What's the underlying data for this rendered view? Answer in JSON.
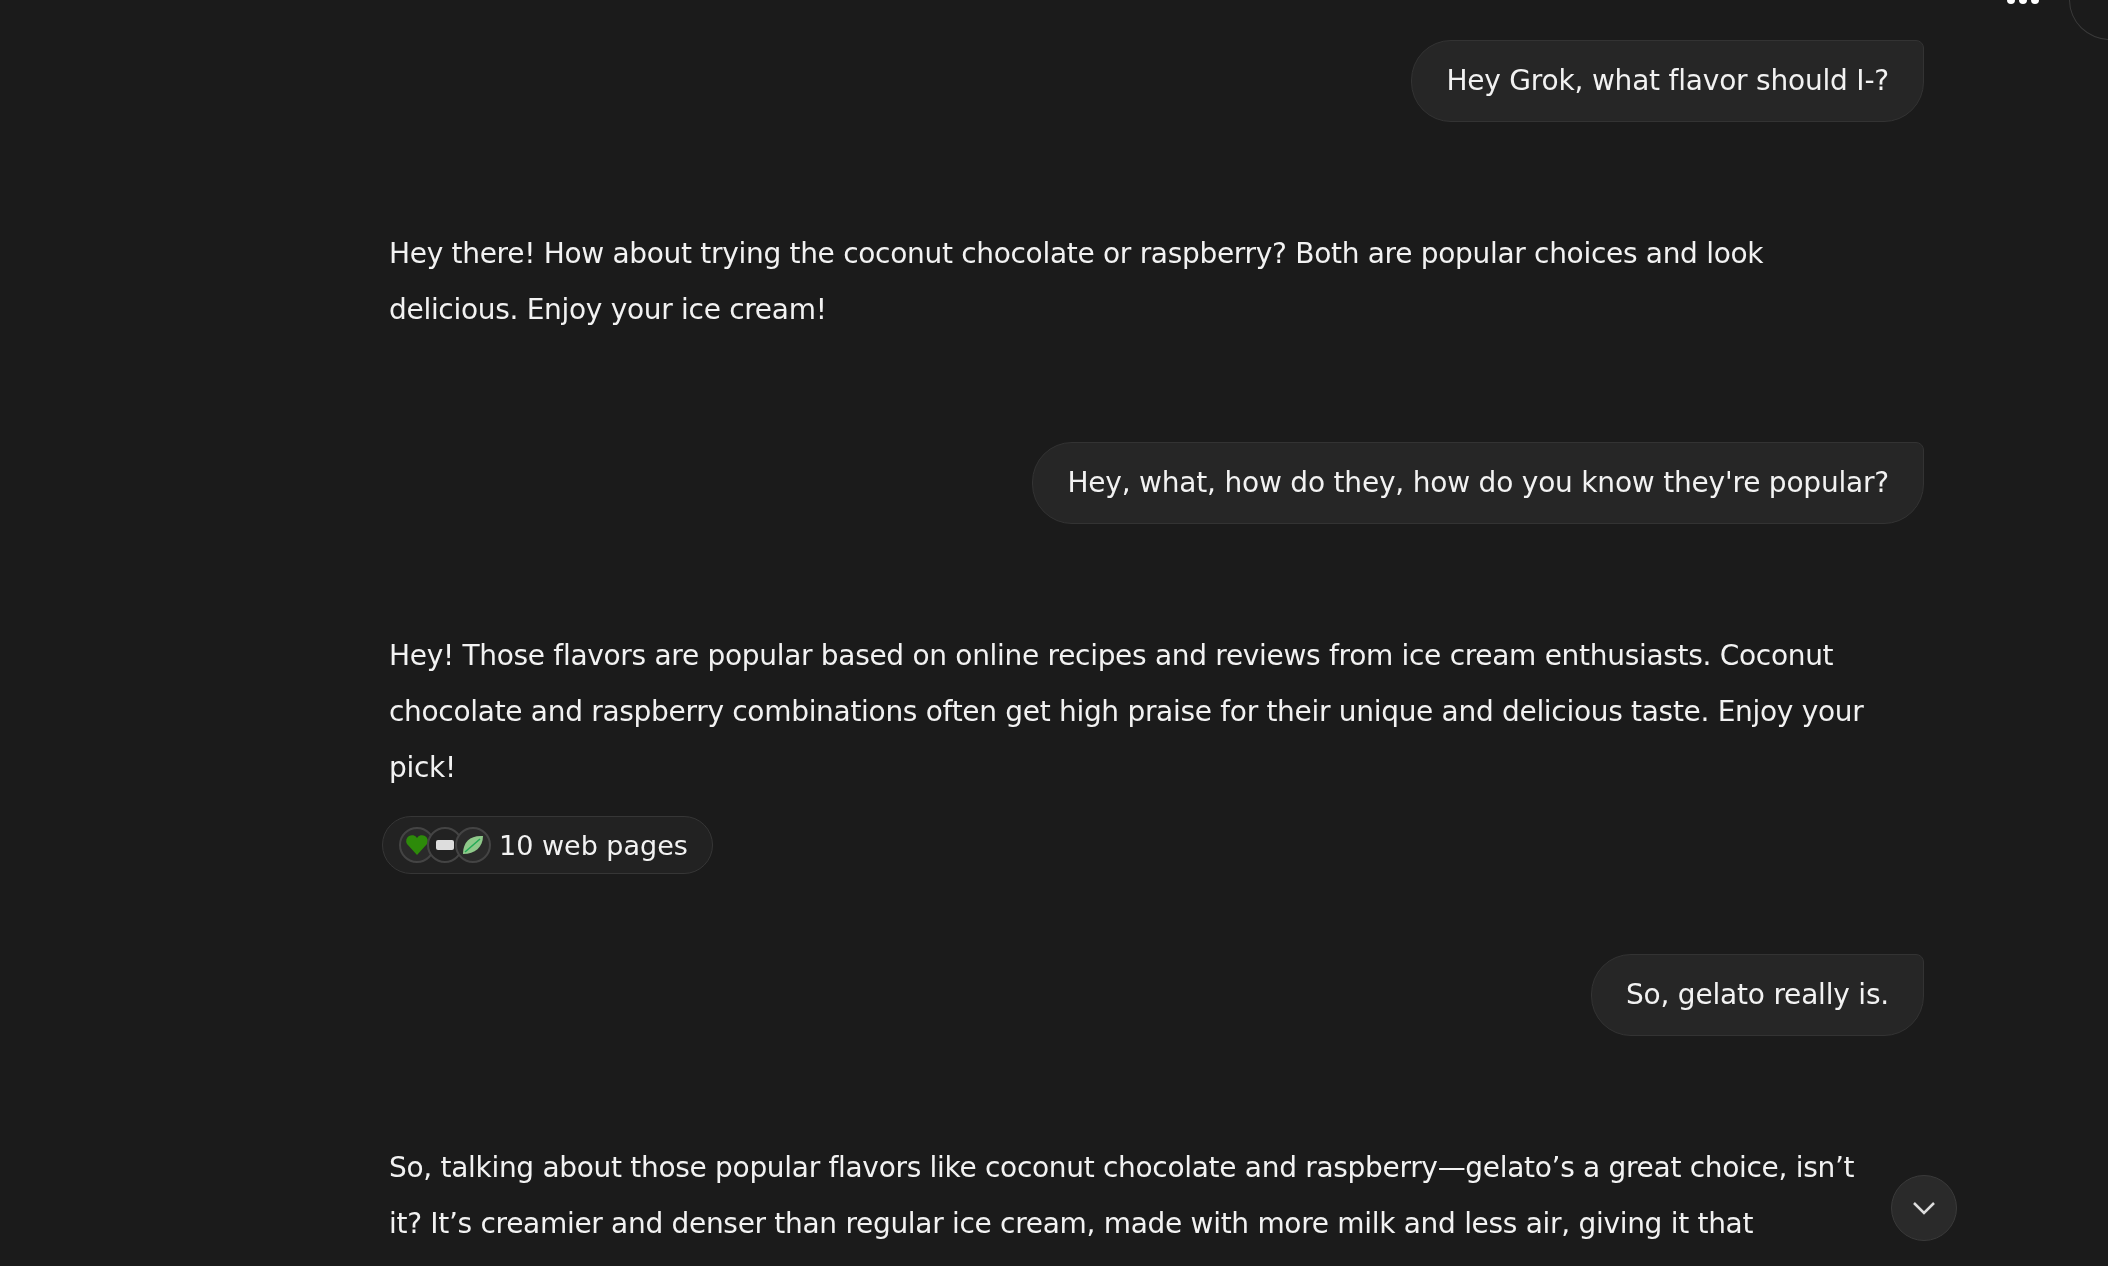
{
  "messages": [
    {
      "kind": "user",
      "text": "Hey Grok, what flavor should I-?"
    },
    {
      "kind": "assistant",
      "text": "Hey there! How about trying the coconut chocolate or raspberry? Both are popular choices and look delicious. Enjoy your ice cream!"
    },
    {
      "kind": "user",
      "text": "Hey, what, how do they, how do you know they're popular?"
    },
    {
      "kind": "assistant",
      "text": "Hey! Those flavors are popular based on online recipes and reviews from ice cream enthusiasts. Coconut chocolate and raspberry combinations often get high praise for their unique and delicious taste. Enjoy your pick!",
      "sources": {
        "label": "10 web pages"
      }
    },
    {
      "kind": "user",
      "text": "So, gelato really is."
    },
    {
      "kind": "assistant",
      "text": "So, talking about those popular flavors like coconut chocolate and raspberry—gelato’s a great choice, isn’t it? It’s creamier and denser than regular ice cream, made with more milk and less air, giving it that"
    }
  ]
}
